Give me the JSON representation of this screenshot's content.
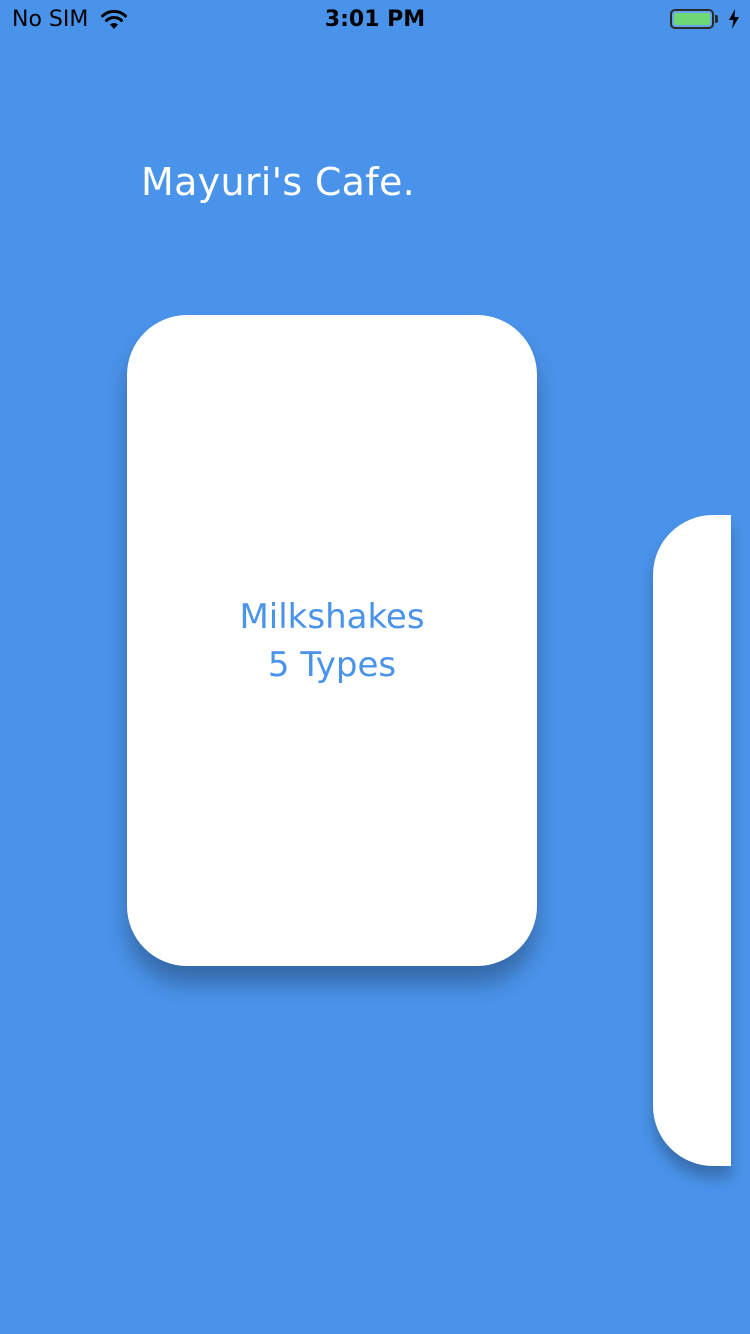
{
  "status_bar": {
    "carrier": "No SIM",
    "time": "3:01 PM",
    "battery_level": 1.0,
    "battery_color": "#6ED874",
    "icons": [
      "wifi-icon",
      "battery-icon",
      "charging-icon"
    ]
  },
  "app": {
    "title": "Mayuri's Cafe.",
    "background_color": "#4A93EA"
  },
  "cards": [
    {
      "name": "Milkshakes",
      "subtitle": "5 Types",
      "text_color": "#4A93EA",
      "background_color": "#FFFFFF"
    },
    {
      "name": "",
      "subtitle": "",
      "background_color": "#FFFFFF"
    }
  ]
}
